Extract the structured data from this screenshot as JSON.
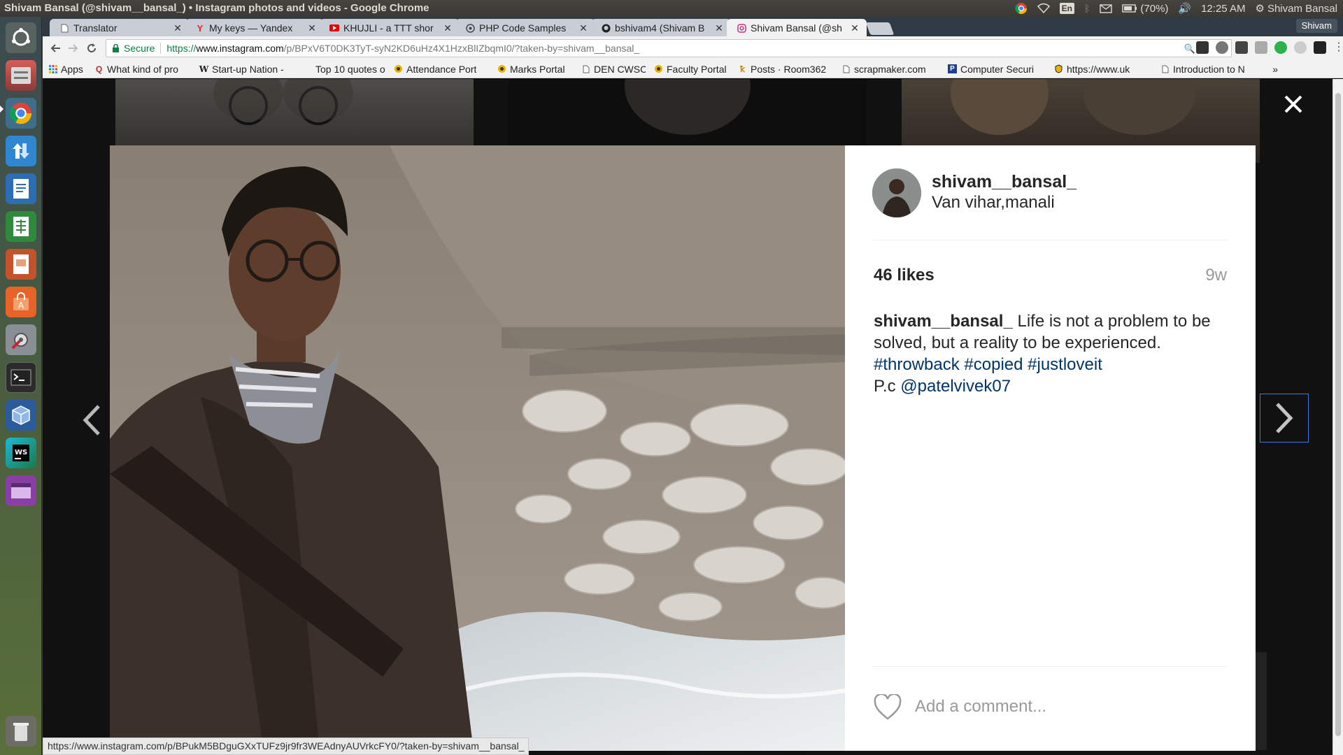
{
  "window_title": "Shivam Bansal (@shivam__bansal_) • Instagram photos and videos - Google Chrome",
  "panel": {
    "language": "En",
    "battery": "(70%)",
    "time": "12:25 AM",
    "user": "Shivam Bansal"
  },
  "tabs": [
    {
      "title": "Translator",
      "icon": "doc-icon"
    },
    {
      "title": "My keys — Yandex",
      "icon": "yandex-icon"
    },
    {
      "title": "KHUJLI - a TTT shor",
      "icon": "youtube-icon"
    },
    {
      "title": "PHP Code Samples",
      "icon": "php-icon"
    },
    {
      "title": "bshivam4 (Shivam B",
      "icon": "github-icon"
    },
    {
      "title": "Shivam Bansal (@sh",
      "icon": "instagram-icon",
      "active": true
    }
  ],
  "profile_name": "Shivam",
  "address_bar": {
    "secure_label": "Secure",
    "scheme": "https://",
    "host": "www.instagram.com",
    "path": "/p/BPxV6T0DK3TyT-syN2KD6uHz4X1HzxBlIZbqmI0/?taken-by=shivam__bansal_"
  },
  "bookmarks": [
    {
      "label": "Apps",
      "icon": "apps-icon"
    },
    {
      "label": "What kind of pro",
      "icon": "quora-icon"
    },
    {
      "label": "Start-up Nation -",
      "icon": "wiki-icon"
    },
    {
      "label": "Top 10 quotes of",
      "icon": "blank-icon"
    },
    {
      "label": "Attendance Port",
      "icon": "college-icon"
    },
    {
      "label": "Marks Portal",
      "icon": "college-icon"
    },
    {
      "label": "DEN CWSC",
      "icon": "page-icon"
    },
    {
      "label": "Faculty Portal",
      "icon": "college-icon"
    },
    {
      "label": "Posts · Room362",
      "icon": "room-icon"
    },
    {
      "label": "scrapmaker.com",
      "icon": "page-icon"
    },
    {
      "label": "Computer Securi",
      "icon": "p-icon"
    },
    {
      "label": "https://www.uk",
      "icon": "shield-icon"
    },
    {
      "label": "Introduction to N",
      "icon": "page-icon"
    }
  ],
  "post": {
    "username": "shivam__bansal_",
    "location": "Van vihar,manali",
    "likes": "46 likes",
    "age": "9w",
    "caption_user": "shivam__bansal_",
    "caption_text": "Life is not a problem to be solved, but a reality to be experienced.",
    "hashtags": [
      "#throwback",
      "#copied",
      "#justloveit"
    ],
    "credit_prefix": "P.c",
    "credit_mention": "@patelvivek07",
    "comment_placeholder": "Add a comment..."
  },
  "status_url": "https://www.instagram.com/p/BPukM5BDguGXxTUFz9jr9fr3WEAdnyAUVrkcFY0/?taken-by=shivam__bansal_",
  "colors": {
    "link": "#003569",
    "secure": "#0b8043",
    "tabstrip": "#303a44",
    "focus_border": "#3b7bd6"
  }
}
